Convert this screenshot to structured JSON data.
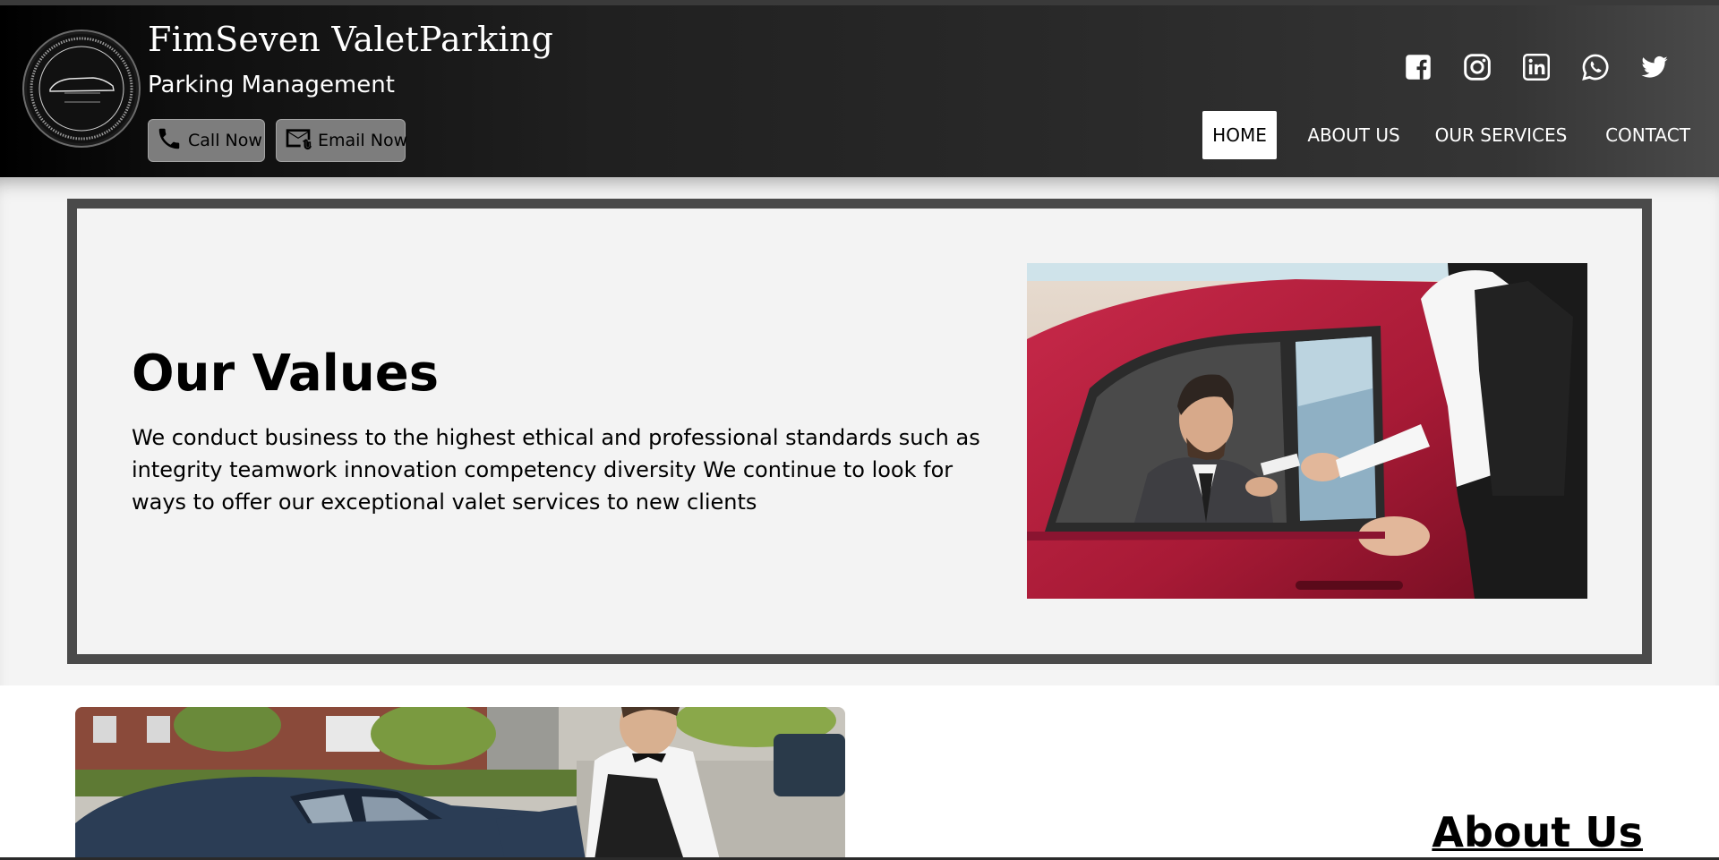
{
  "header": {
    "brand_title": "FimSeven ValetParking",
    "brand_subtitle": "Parking Management",
    "logo_text": "FIM SEVEN",
    "call_label": "Call Now",
    "email_label": "Email Now",
    "social_icons": [
      "facebook-icon",
      "instagram-icon",
      "linkedin-icon",
      "whatsapp-icon",
      "twitter-icon"
    ],
    "nav": [
      {
        "label": "HOME",
        "active": true
      },
      {
        "label": "ABOUT US",
        "active": false
      },
      {
        "label": "OUR SERVICES",
        "active": false
      },
      {
        "label": "CONTACT",
        "active": false
      }
    ]
  },
  "values": {
    "title": "Our Values",
    "text": "We conduct business to the highest ethical and professional standards such as integrity teamwork innovation competency diversity We continue to look for ways to offer our exceptional valet services to new clients"
  },
  "about": {
    "title": "About Us"
  },
  "colors": {
    "header_start": "#000000",
    "header_end": "#4a4a4a",
    "button_bg": "#7d7d7d",
    "box_border": "#4a4a4a",
    "band_bg": "#f4f4f4",
    "car_red": "#b01f3c"
  }
}
